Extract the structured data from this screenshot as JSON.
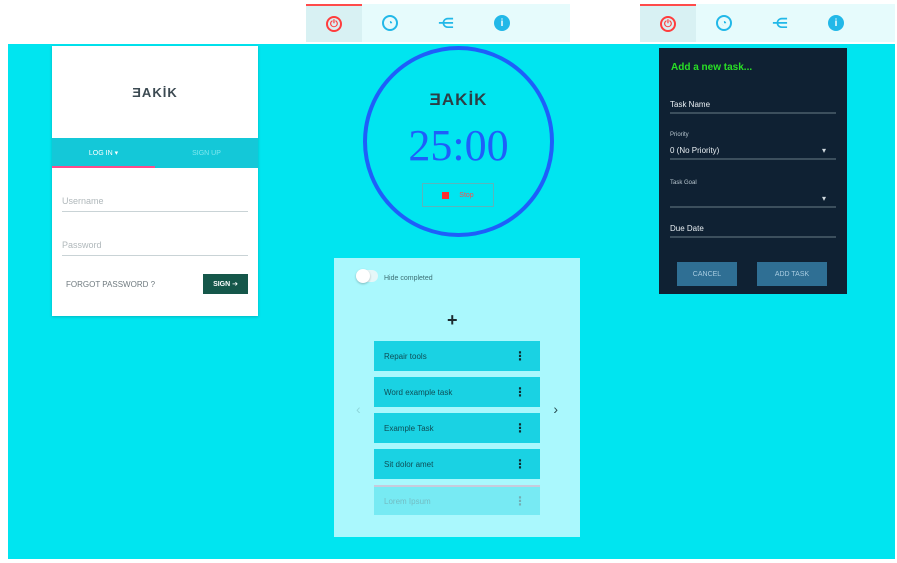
{
  "nav_left": {
    "items": [
      {
        "icon": "power-icon"
      },
      {
        "icon": "user-icon"
      },
      {
        "icon": "share-icon"
      },
      {
        "icon": "info-icon"
      }
    ]
  },
  "nav_right": {
    "items": [
      {
        "icon": "power-icon"
      },
      {
        "icon": "user-icon"
      },
      {
        "icon": "share-icon"
      },
      {
        "icon": "info-icon"
      }
    ]
  },
  "login": {
    "logo": "ƎAKİK",
    "tab_signin": "LOG IN ▾",
    "tab_signup": "SIGN UP",
    "username_placeholder": "Username",
    "password_placeholder": "Password",
    "forgot_label": "FORGOT PASSWORD ?",
    "sign_label": "SIGN ➔"
  },
  "timer": {
    "logo": "ƎAKİK",
    "time": "25:00",
    "stop_label": "Stop"
  },
  "tasks": {
    "hide_label": "Hide completed",
    "add_symbol": "+",
    "items": [
      {
        "title": "Repair tools"
      },
      {
        "title": "Word example task"
      },
      {
        "title": "Example Task"
      },
      {
        "title": "Sit dolor amet"
      },
      {
        "title": "Lorem Ipsum"
      }
    ]
  },
  "add_task": {
    "title": "Add a new task...",
    "task_name_label": "Task Name",
    "priority_label": "Priority",
    "priority_value": "0 (No Priority)",
    "task_goal_label": "Task Goal",
    "due_date_label": "Due Date",
    "cancel_label": "CANCEL",
    "add_label": "ADD TASK"
  },
  "colors": {
    "background": "#00e5f0",
    "accent_blue": "#1e5ffa",
    "panel_dark": "#0f2133",
    "accent_green": "#29e025",
    "danger": "#ff3d3d"
  }
}
